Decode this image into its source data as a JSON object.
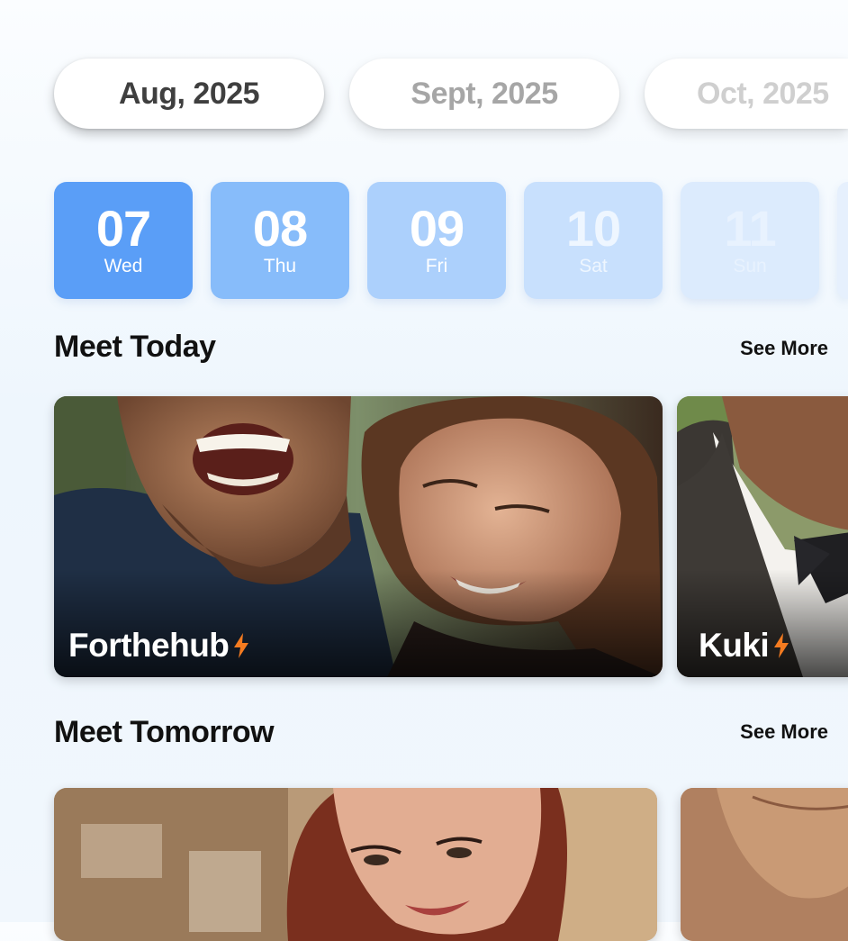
{
  "months": [
    {
      "label": "Aug, 2025",
      "color": "#3f3f3f",
      "active": true
    },
    {
      "label": "Sept, 2025",
      "color": "#a6a6a6",
      "active": false
    },
    {
      "label": "Oct, 2025",
      "color": "#cfcfcf",
      "active": false
    }
  ],
  "dates": [
    {
      "num": "07",
      "day": "Wed",
      "bg": "#5a9ef7",
      "fg": "#ffffff"
    },
    {
      "num": "08",
      "day": "Thu",
      "bg": "#87bcfa",
      "fg": "#ffffff"
    },
    {
      "num": "09",
      "day": "Fri",
      "bg": "#acd0fc",
      "fg": "#ffffff"
    },
    {
      "num": "10",
      "day": "Sat",
      "bg": "#c8e0fd",
      "fg": "#f0f7ff"
    },
    {
      "num": "11",
      "day": "Sun",
      "bg": "#dcebfd",
      "fg": "#e9f2fe"
    }
  ],
  "sections": {
    "today": {
      "title": "Meet Today",
      "see_more": "See More"
    },
    "tomorrow": {
      "title": "Meet Tomorrow",
      "see_more": "See More"
    }
  },
  "today_cards": [
    {
      "name": "Forthehub",
      "icon": "lightning-bolt-icon"
    },
    {
      "name": "Kuki",
      "icon": "lightning-bolt-icon"
    }
  ],
  "colors": {
    "accent": "#5a9ef7",
    "bolt": "#f47b20"
  }
}
